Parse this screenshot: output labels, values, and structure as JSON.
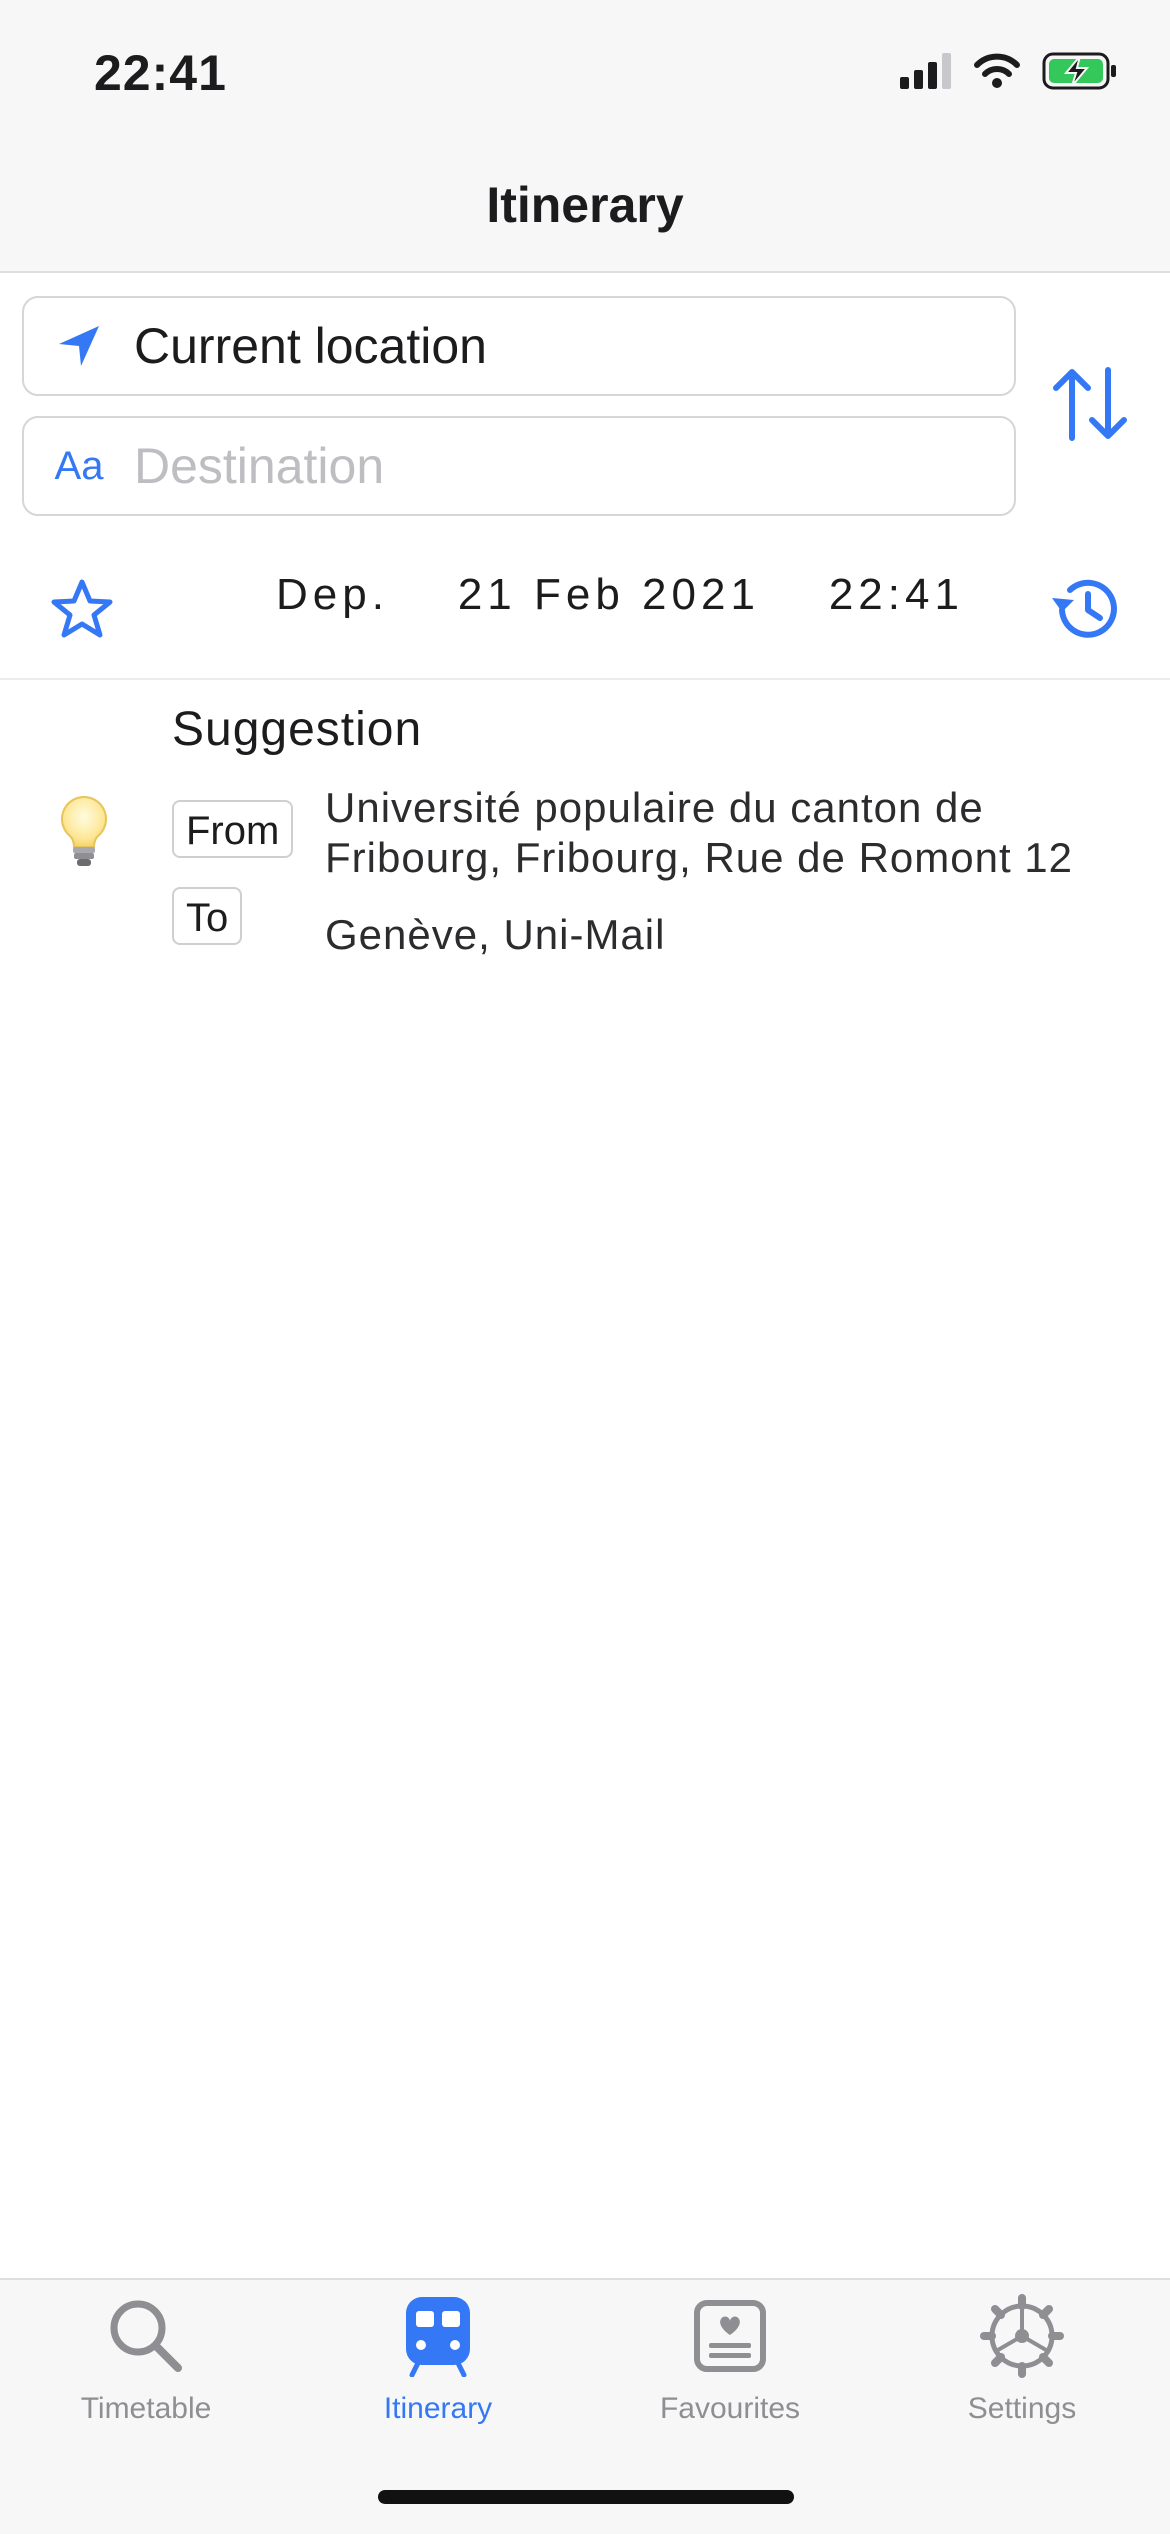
{
  "status_bar": {
    "time": "22:41"
  },
  "nav": {
    "title": "Itinerary"
  },
  "origin": {
    "value": "Current location"
  },
  "destination": {
    "prefix": "Aa",
    "placeholder": "Destination"
  },
  "date": {
    "label": "Dep.    21 Feb 2021    22:41"
  },
  "suggestion": {
    "title": "Suggestion",
    "from_tag": "From",
    "to_tag": "To",
    "from_line1": "Université populaire du canton de",
    "from_line2": "Fribourg, Fribourg, Rue de Romont 12",
    "to": "Genève, Uni-Mail"
  },
  "tabs": [
    {
      "label": "Timetable",
      "icon": "search-icon"
    },
    {
      "label": "Itinerary",
      "icon": "train-icon",
      "active": true
    },
    {
      "label": "Favourites",
      "icon": "favourites-icon"
    },
    {
      "label": "Settings",
      "icon": "gear-icon"
    }
  ],
  "colors": {
    "accent": "#3478f6",
    "inactive": "#8e8e93"
  }
}
